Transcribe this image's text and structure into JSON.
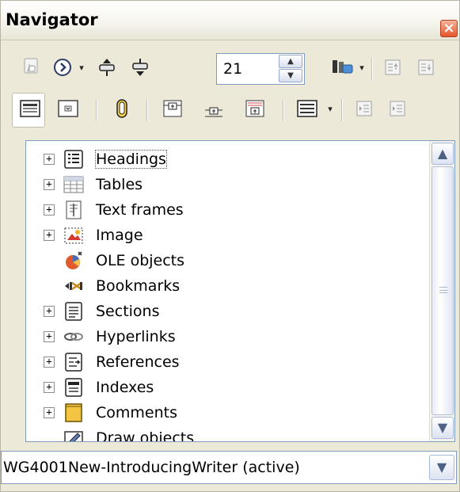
{
  "window": {
    "title": "Navigator",
    "close_glyph": "×"
  },
  "toolbar": {
    "page_number": "21",
    "spin_up_glyph": "▲",
    "spin_down_glyph": "▼",
    "dropdown_glyph": "▾"
  },
  "tree": {
    "items": [
      {
        "label": "Headings",
        "expandable": true,
        "icon": "headings-icon",
        "selected": true
      },
      {
        "label": "Tables",
        "expandable": true,
        "icon": "table-icon"
      },
      {
        "label": "Text frames",
        "expandable": true,
        "icon": "text-frame-icon"
      },
      {
        "label": "Image",
        "expandable": true,
        "icon": "image-icon"
      },
      {
        "label": "OLE objects",
        "expandable": false,
        "icon": "ole-object-icon"
      },
      {
        "label": "Bookmarks",
        "expandable": false,
        "icon": "bookmark-icon"
      },
      {
        "label": "Sections",
        "expandable": true,
        "icon": "section-icon"
      },
      {
        "label": "Hyperlinks",
        "expandable": true,
        "icon": "hyperlink-icon"
      },
      {
        "label": "References",
        "expandable": true,
        "icon": "reference-icon"
      },
      {
        "label": "Indexes",
        "expandable": true,
        "icon": "index-icon"
      },
      {
        "label": "Comments",
        "expandable": true,
        "icon": "comment-icon"
      },
      {
        "label": "Draw objects",
        "expandable": false,
        "icon": "draw-object-icon"
      }
    ],
    "expander_glyph": "+",
    "scroll_up_glyph": "▲",
    "scroll_down_glyph": "▼"
  },
  "document_select": {
    "value": "WG4001New-IntroducingWriter (active)",
    "arrow_glyph": "▼"
  },
  "colors": {
    "panel_bg": "#ece9d8",
    "close_red": "#e2552b",
    "selection_border": "#555555"
  }
}
